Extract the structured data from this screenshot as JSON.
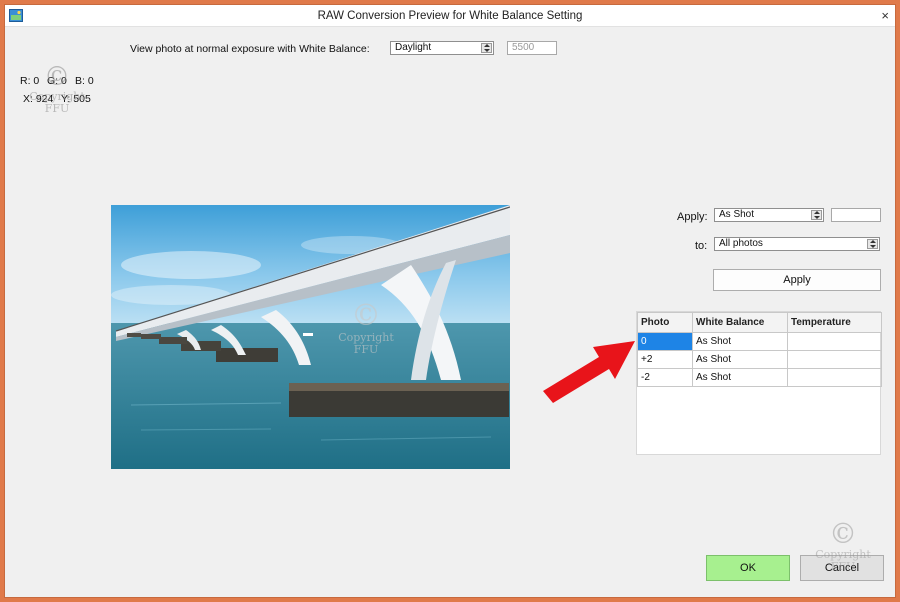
{
  "window": {
    "title": "RAW Conversion Preview for White Balance Setting",
    "close_glyph": "×"
  },
  "top": {
    "view_label": "View photo at normal exposure with White Balance:",
    "wb_select": "Daylight",
    "temperature_value": "5500"
  },
  "pixel_info": {
    "r": "R: 0",
    "g": "G: 0",
    "b": "B: 0",
    "x": "X: 924",
    "y": "Y: 505"
  },
  "apply_panel": {
    "apply_label": "Apply:",
    "apply_select": "As Shot",
    "to_label": "to:",
    "to_select": "All photos",
    "apply_button": "Apply"
  },
  "table": {
    "headers": [
      "Photo",
      "White Balance",
      "Temperature"
    ],
    "rows": [
      [
        "0",
        "As Shot",
        ""
      ],
      [
        "+2",
        "As Shot",
        ""
      ],
      [
        "-2",
        "As Shot",
        ""
      ]
    ]
  },
  "watermark": {
    "symbol": "©",
    "line1": "Copyright",
    "line2": "FFU"
  },
  "buttons": {
    "ok": "OK",
    "cancel": "Cancel"
  },
  "colors": {
    "frame": "#e07a4a",
    "ok_green": "#a7f08f",
    "selected_blue": "#1e84e6",
    "arrow_red": "#e8141a"
  }
}
